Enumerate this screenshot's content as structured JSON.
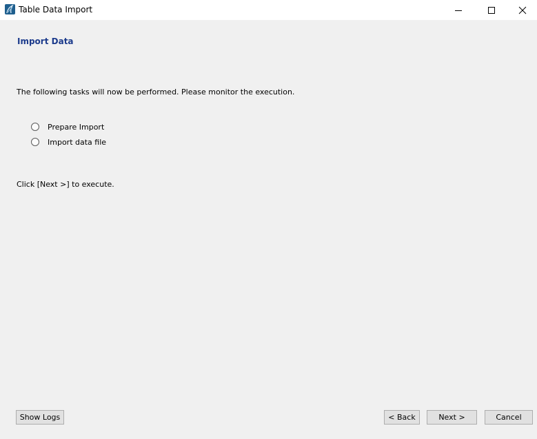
{
  "window": {
    "title": "Table Data Import",
    "icon": "mysql-workbench-icon",
    "controls": [
      "minimize-icon",
      "maximize-icon",
      "close-icon"
    ]
  },
  "page": {
    "title": "Import Data",
    "intro": "The following tasks will now be performed. Please monitor the execution.",
    "tasks": [
      {
        "label": "Prepare Import"
      },
      {
        "label": "Import data file"
      }
    ],
    "hint": "Click [Next >] to execute."
  },
  "buttons": {
    "show_logs": "Show Logs",
    "back": "< Back",
    "next": "Next >",
    "cancel": "Cancel"
  },
  "colors": {
    "background": "#f0f0f0",
    "titlebar": "#ffffff",
    "heading": "#1c3b8c",
    "button_face": "#e1e1e1",
    "button_border": "#adadad"
  }
}
